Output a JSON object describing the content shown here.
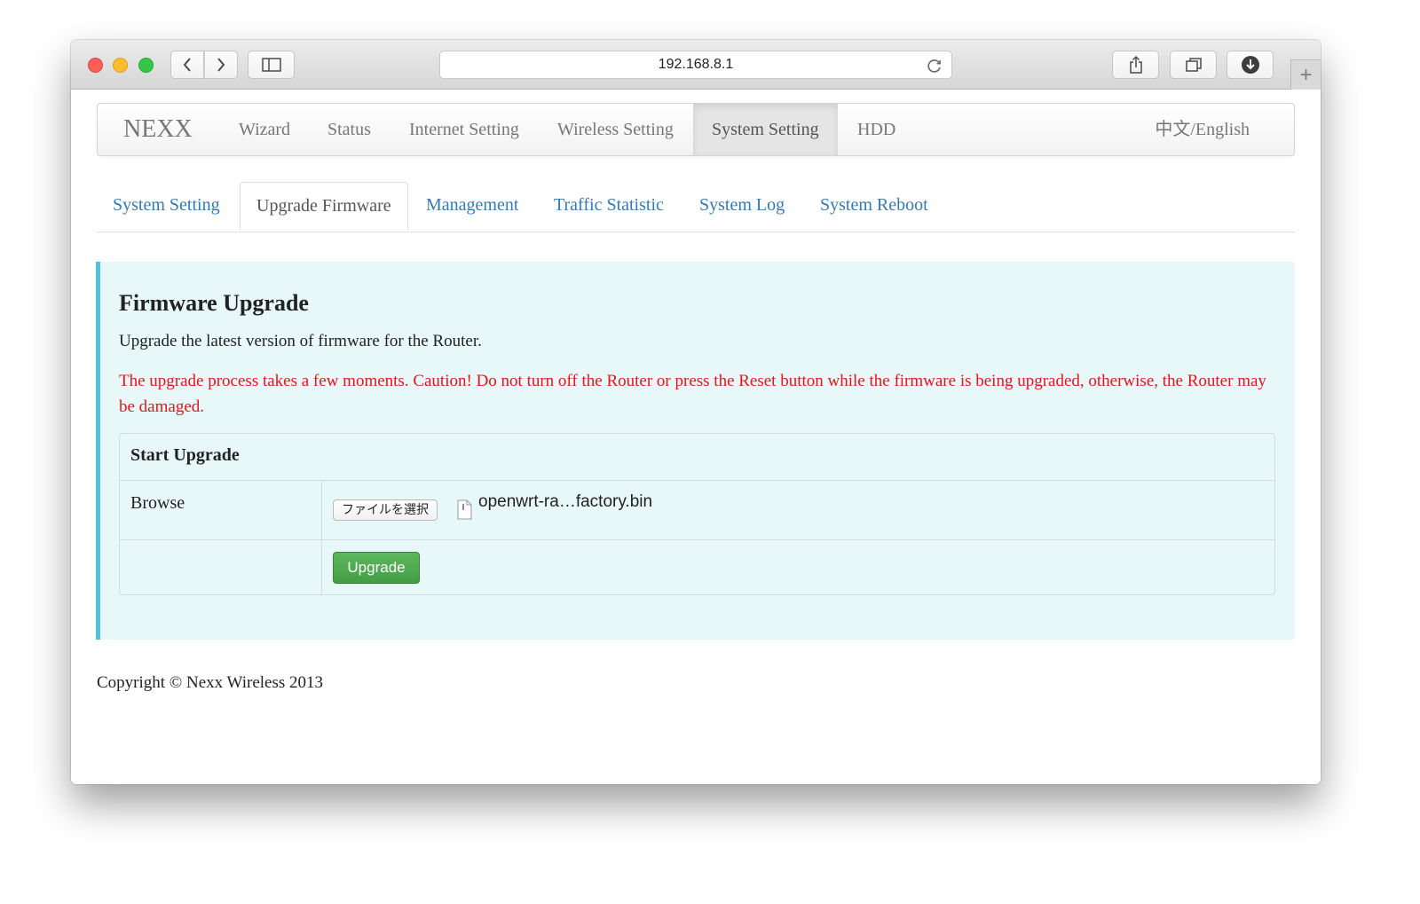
{
  "browser": {
    "url": "192.168.8.1",
    "new_tab_label": "+"
  },
  "navbar": {
    "brand": "NEXX",
    "items": [
      {
        "label": "Wizard"
      },
      {
        "label": "Status"
      },
      {
        "label": "Internet Setting"
      },
      {
        "label": "Wireless Setting"
      },
      {
        "label": "System Setting"
      },
      {
        "label": "HDD"
      }
    ],
    "active_item": "System Setting",
    "language": "中文/English"
  },
  "subtabs": {
    "items": [
      {
        "label": "System Setting"
      },
      {
        "label": "Upgrade Firmware"
      },
      {
        "label": "Management"
      },
      {
        "label": "Traffic Statistic"
      },
      {
        "label": "System Log"
      },
      {
        "label": "System Reboot"
      }
    ],
    "active_item": "Upgrade Firmware"
  },
  "panel": {
    "title": "Firmware Upgrade",
    "description": "Upgrade the latest version of firmware for the Router.",
    "warning": "The upgrade process takes a few moments. Caution! Do not turn off the Router or press the Reset button while the firmware is being upgraded, otherwise, the Router may be damaged.",
    "table": {
      "header": "Start Upgrade",
      "browse_label": "Browse",
      "file_button_label": "ファイルを選択",
      "selected_file": "openwrt-ra…factory.bin",
      "upgrade_button_label": "Upgrade"
    }
  },
  "footer": {
    "copyright": "Copyright © Nexx Wireless 2013"
  },
  "colors": {
    "link": "#337ab7",
    "warning": "#e8131c",
    "panel_bg": "#e8f8f8",
    "panel_accent": "#4fc3dc",
    "button_green": "#5cb85c"
  }
}
